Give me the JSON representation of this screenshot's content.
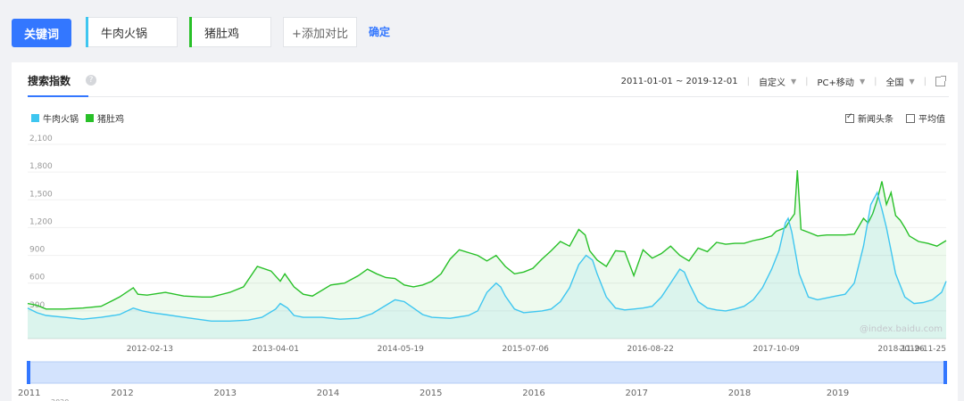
{
  "toolbar": {
    "keyword_button": "关键词",
    "keyword1": "牛肉火锅",
    "keyword2": "猪肚鸡",
    "add_compare": "+添加对比",
    "confirm": "确定"
  },
  "panel": {
    "title": "搜索指数",
    "help": "?",
    "date_range": "2011-01-01 ~ 2019-12-01",
    "custom": "自定义",
    "device": "PC+移动",
    "region": "全国",
    "opt_news": "新闻头条",
    "opt_avg": "平均值",
    "watermark": "@index.baidu.com"
  },
  "colors": {
    "series1": "#3ec6f0",
    "series2": "#28c028",
    "accent": "#3377ff"
  },
  "chart_data": {
    "type": "line",
    "ylim": [
      0,
      2100
    ],
    "yticks": [
      "2,100",
      "1,800",
      "1,500",
      "1,200",
      "900",
      "600",
      "300"
    ],
    "ytick_values": [
      2100,
      1800,
      1500,
      1200,
      900,
      600,
      300
    ],
    "xticks": [
      "2012-02-13",
      "2013-04-01",
      "2014-05-19",
      "2015-07-06",
      "2016-08-22",
      "2017-10-09",
      "2018-11-26",
      "2019-11-25"
    ],
    "xtick_positions": [
      0.133,
      0.27,
      0.406,
      0.542,
      0.678,
      0.815,
      0.951,
      1.0
    ],
    "navigator_years": [
      "2011",
      "2012",
      "2013",
      "2014",
      "2015",
      "2016",
      "2017",
      "2018",
      "2019"
    ],
    "navigator_sub": "2020",
    "series": [
      {
        "name": "牛肉火锅",
        "values": [
          [
            0,
            330
          ],
          [
            0.01,
            280
          ],
          [
            0.02,
            250
          ],
          [
            0.04,
            230
          ],
          [
            0.06,
            210
          ],
          [
            0.08,
            230
          ],
          [
            0.1,
            260
          ],
          [
            0.115,
            330
          ],
          [
            0.125,
            300
          ],
          [
            0.135,
            280
          ],
          [
            0.15,
            260
          ],
          [
            0.17,
            230
          ],
          [
            0.2,
            190
          ],
          [
            0.22,
            190
          ],
          [
            0.24,
            200
          ],
          [
            0.255,
            230
          ],
          [
            0.27,
            320
          ],
          [
            0.275,
            380
          ],
          [
            0.283,
            330
          ],
          [
            0.29,
            250
          ],
          [
            0.3,
            230
          ],
          [
            0.32,
            230
          ],
          [
            0.34,
            210
          ],
          [
            0.36,
            220
          ],
          [
            0.375,
            270
          ],
          [
            0.39,
            360
          ],
          [
            0.4,
            420
          ],
          [
            0.41,
            400
          ],
          [
            0.42,
            330
          ],
          [
            0.43,
            260
          ],
          [
            0.44,
            230
          ],
          [
            0.46,
            220
          ],
          [
            0.48,
            250
          ],
          [
            0.49,
            300
          ],
          [
            0.5,
            500
          ],
          [
            0.51,
            600
          ],
          [
            0.515,
            560
          ],
          [
            0.52,
            460
          ],
          [
            0.53,
            320
          ],
          [
            0.54,
            280
          ],
          [
            0.55,
            290
          ],
          [
            0.56,
            300
          ],
          [
            0.57,
            320
          ],
          [
            0.58,
            400
          ],
          [
            0.59,
            550
          ],
          [
            0.6,
            800
          ],
          [
            0.608,
            900
          ],
          [
            0.615,
            850
          ],
          [
            0.62,
            700
          ],
          [
            0.63,
            450
          ],
          [
            0.64,
            330
          ],
          [
            0.65,
            310
          ],
          [
            0.66,
            320
          ],
          [
            0.67,
            330
          ],
          [
            0.68,
            350
          ],
          [
            0.69,
            450
          ],
          [
            0.7,
            600
          ],
          [
            0.71,
            750
          ],
          [
            0.715,
            720
          ],
          [
            0.72,
            600
          ],
          [
            0.73,
            400
          ],
          [
            0.74,
            330
          ],
          [
            0.75,
            310
          ],
          [
            0.76,
            300
          ],
          [
            0.77,
            320
          ],
          [
            0.78,
            350
          ],
          [
            0.79,
            420
          ],
          [
            0.8,
            550
          ],
          [
            0.81,
            750
          ],
          [
            0.818,
            950
          ],
          [
            0.825,
            1250
          ],
          [
            0.828,
            1300
          ],
          [
            0.832,
            1150
          ],
          [
            0.84,
            700
          ],
          [
            0.85,
            450
          ],
          [
            0.86,
            420
          ],
          [
            0.87,
            440
          ],
          [
            0.88,
            460
          ],
          [
            0.89,
            480
          ],
          [
            0.9,
            600
          ],
          [
            0.91,
            1000
          ],
          [
            0.918,
            1450
          ],
          [
            0.925,
            1580
          ],
          [
            0.93,
            1400
          ],
          [
            0.935,
            1200
          ],
          [
            0.94,
            950
          ],
          [
            0.945,
            700
          ],
          [
            0.955,
            450
          ],
          [
            0.965,
            380
          ],
          [
            0.975,
            390
          ],
          [
            0.985,
            420
          ],
          [
            0.995,
            500
          ],
          [
            1.0,
            620
          ]
        ]
      },
      {
        "name": "猪肚鸡",
        "values": [
          [
            0,
            380
          ],
          [
            0.01,
            360
          ],
          [
            0.02,
            320
          ],
          [
            0.04,
            320
          ],
          [
            0.06,
            330
          ],
          [
            0.08,
            350
          ],
          [
            0.1,
            450
          ],
          [
            0.115,
            550
          ],
          [
            0.12,
            480
          ],
          [
            0.13,
            470
          ],
          [
            0.15,
            500
          ],
          [
            0.17,
            460
          ],
          [
            0.19,
            450
          ],
          [
            0.2,
            450
          ],
          [
            0.22,
            500
          ],
          [
            0.235,
            560
          ],
          [
            0.25,
            780
          ],
          [
            0.265,
            730
          ],
          [
            0.275,
            620
          ],
          [
            0.28,
            700
          ],
          [
            0.29,
            560
          ],
          [
            0.3,
            480
          ],
          [
            0.31,
            460
          ],
          [
            0.33,
            580
          ],
          [
            0.345,
            600
          ],
          [
            0.36,
            680
          ],
          [
            0.37,
            750
          ],
          [
            0.38,
            700
          ],
          [
            0.39,
            660
          ],
          [
            0.4,
            650
          ],
          [
            0.41,
            580
          ],
          [
            0.42,
            560
          ],
          [
            0.43,
            580
          ],
          [
            0.44,
            620
          ],
          [
            0.45,
            700
          ],
          [
            0.46,
            860
          ],
          [
            0.47,
            960
          ],
          [
            0.48,
            930
          ],
          [
            0.49,
            900
          ],
          [
            0.5,
            840
          ],
          [
            0.51,
            900
          ],
          [
            0.52,
            780
          ],
          [
            0.53,
            700
          ],
          [
            0.54,
            720
          ],
          [
            0.55,
            760
          ],
          [
            0.56,
            860
          ],
          [
            0.57,
            950
          ],
          [
            0.58,
            1050
          ],
          [
            0.59,
            1000
          ],
          [
            0.6,
            1180
          ],
          [
            0.607,
            1120
          ],
          [
            0.612,
            950
          ],
          [
            0.62,
            850
          ],
          [
            0.63,
            780
          ],
          [
            0.64,
            950
          ],
          [
            0.65,
            940
          ],
          [
            0.66,
            680
          ],
          [
            0.67,
            960
          ],
          [
            0.68,
            870
          ],
          [
            0.69,
            920
          ],
          [
            0.7,
            1000
          ],
          [
            0.71,
            900
          ],
          [
            0.72,
            840
          ],
          [
            0.73,
            980
          ],
          [
            0.74,
            940
          ],
          [
            0.75,
            1040
          ],
          [
            0.76,
            1020
          ],
          [
            0.77,
            1030
          ],
          [
            0.78,
            1030
          ],
          [
            0.79,
            1060
          ],
          [
            0.8,
            1080
          ],
          [
            0.81,
            1110
          ],
          [
            0.815,
            1160
          ],
          [
            0.825,
            1200
          ],
          [
            0.83,
            1280
          ],
          [
            0.835,
            1350
          ],
          [
            0.838,
            1820
          ],
          [
            0.842,
            1180
          ],
          [
            0.85,
            1150
          ],
          [
            0.86,
            1110
          ],
          [
            0.87,
            1120
          ],
          [
            0.88,
            1120
          ],
          [
            0.89,
            1120
          ],
          [
            0.9,
            1130
          ],
          [
            0.91,
            1300
          ],
          [
            0.915,
            1250
          ],
          [
            0.92,
            1350
          ],
          [
            0.925,
            1500
          ],
          [
            0.93,
            1700
          ],
          [
            0.935,
            1450
          ],
          [
            0.94,
            1580
          ],
          [
            0.945,
            1330
          ],
          [
            0.95,
            1280
          ],
          [
            0.955,
            1200
          ],
          [
            0.96,
            1110
          ],
          [
            0.97,
            1050
          ],
          [
            0.98,
            1030
          ],
          [
            0.99,
            1000
          ],
          [
            1.0,
            1060
          ]
        ]
      }
    ]
  }
}
